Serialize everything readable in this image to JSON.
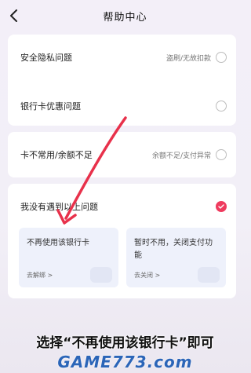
{
  "header": {
    "title": "帮助中心",
    "back_icon": "chevron-left-icon"
  },
  "options": [
    {
      "label": "安全隐私问题",
      "hint": "盗刷/无故扣款",
      "checked": false
    },
    {
      "label": "银行卡优惠问题",
      "hint": "",
      "checked": false
    },
    {
      "label": "卡不常用/余额不足",
      "hint": "余额不足/支付异常",
      "checked": false
    },
    {
      "label": "我没有遇到以上问题",
      "hint": "",
      "checked": true
    }
  ],
  "sub_options": [
    {
      "title": "不再使用该银行卡",
      "link": "去解绑 >"
    },
    {
      "title": "暂时不用，关闭支付功能",
      "link": "去关闭 >"
    }
  ],
  "caption": "选择“不再使用该银行卡”即可",
  "watermark": "GAME773.com",
  "colors": {
    "accent": "#ef3b5e",
    "annotation_arrow": "#e8314b",
    "sub_card_bg": "#eef1fb"
  }
}
